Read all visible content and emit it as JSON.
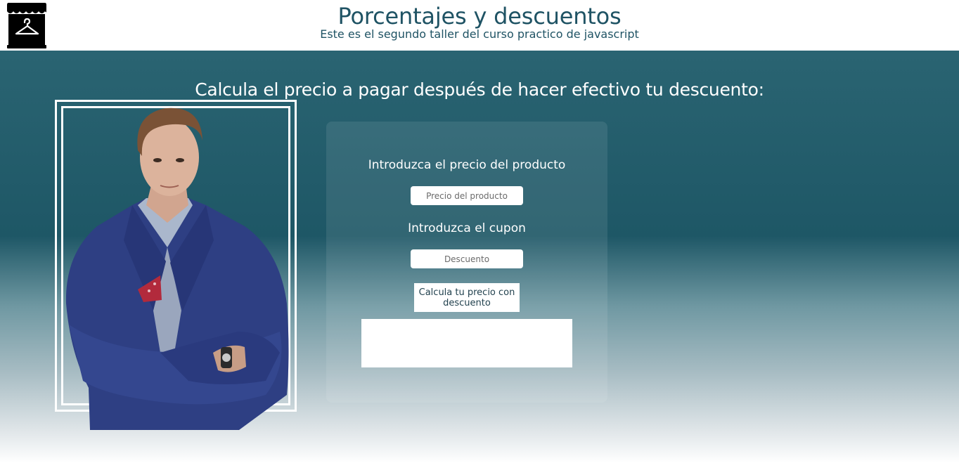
{
  "header": {
    "logo_icon": "store-hanger-icon",
    "title": "Porcentajes y descuentos",
    "subtitle": "Este es el segundo taller del curso practico de javascript"
  },
  "main": {
    "heading": "Calcula el precio a pagar después de hacer efectivo tu descuento:",
    "photo": "man-in-blue-suit-photo",
    "form": {
      "price_label": "Introduzca el precio del producto",
      "price_placeholder": "Precio del producto",
      "price_value": "",
      "coupon_label": "Introduzca el cupon",
      "coupon_placeholder": "Descuento",
      "coupon_value": "",
      "button_label": "Calcula tu precio con descuento",
      "result": ""
    }
  },
  "colors": {
    "title_text": "#1f5364",
    "band_top": "#2a6472",
    "band_bottom": "#ffffff"
  }
}
